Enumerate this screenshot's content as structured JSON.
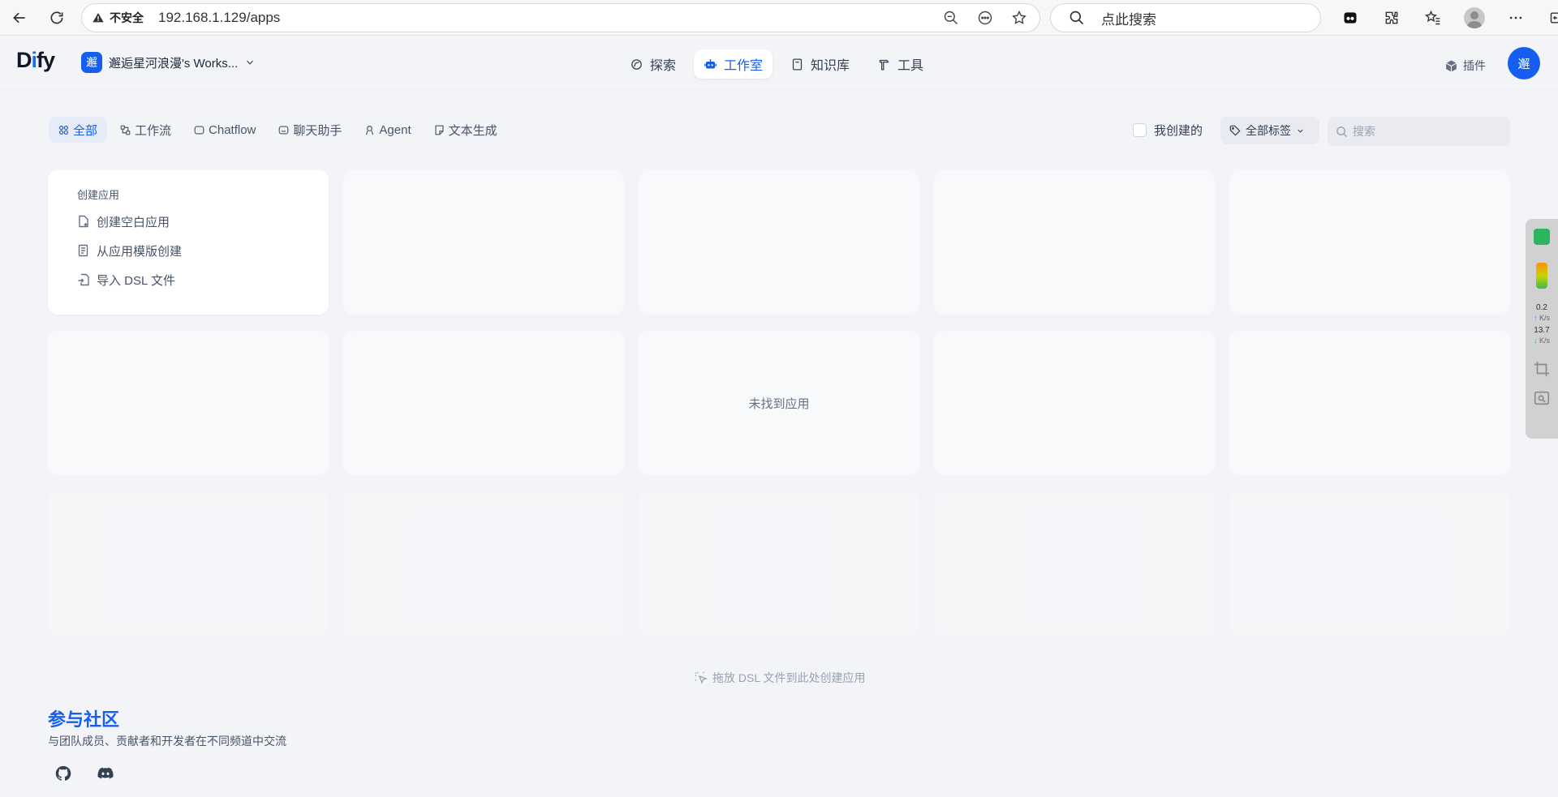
{
  "browser": {
    "security_label": "不安全",
    "url": "192.168.1.129/apps",
    "search_label": "点此搜索"
  },
  "header": {
    "logo_text": "Dify",
    "workspace_name": "邂逅星河浪漫's Works...",
    "workspace_initial": "邂",
    "nav": [
      {
        "label": "探索",
        "icon": "compass-icon"
      },
      {
        "label": "工作室",
        "icon": "robot-icon"
      },
      {
        "label": "知识库",
        "icon": "book-icon"
      },
      {
        "label": "工具",
        "icon": "hammer-icon"
      }
    ],
    "active_nav": "工作室",
    "plugins_label": "插件",
    "user_initial": "邂"
  },
  "filters": {
    "tabs": [
      {
        "label": "全部",
        "icon": "grid-icon",
        "active": true
      },
      {
        "label": "工作流",
        "icon": "workflow-icon",
        "active": false
      },
      {
        "label": "Chatflow",
        "icon": "chatflow-icon",
        "active": false
      },
      {
        "label": "聊天助手",
        "icon": "chat-icon",
        "active": false
      },
      {
        "label": "Agent",
        "icon": "agent-icon",
        "active": false
      },
      {
        "label": "文本生成",
        "icon": "text-icon",
        "active": false
      }
    ],
    "mine_label": "我创建的",
    "mine_checked": false,
    "tags_label": "全部标签",
    "search_placeholder": "搜索",
    "search_value": ""
  },
  "create_card": {
    "title": "创建应用",
    "items": [
      {
        "label": "创建空白应用",
        "icon": "blank-file-icon"
      },
      {
        "label": "从应用模版创建",
        "icon": "template-icon"
      },
      {
        "label": "导入 DSL 文件",
        "icon": "import-icon"
      }
    ]
  },
  "empty_text": "未找到应用",
  "drop_hint": "拖放 DSL 文件到此处创建应用",
  "community": {
    "title": "参与社区",
    "description": "与团队成员、贡献者和开发者在不同频道中交流",
    "links": [
      {
        "name": "github-icon"
      },
      {
        "name": "discord-icon"
      }
    ]
  },
  "side_widget": {
    "up_speed": "0.2",
    "down_speed": "13.7",
    "unit": "K/s"
  },
  "colors": {
    "accent": "#155eef",
    "background": "#f2f4f7"
  }
}
